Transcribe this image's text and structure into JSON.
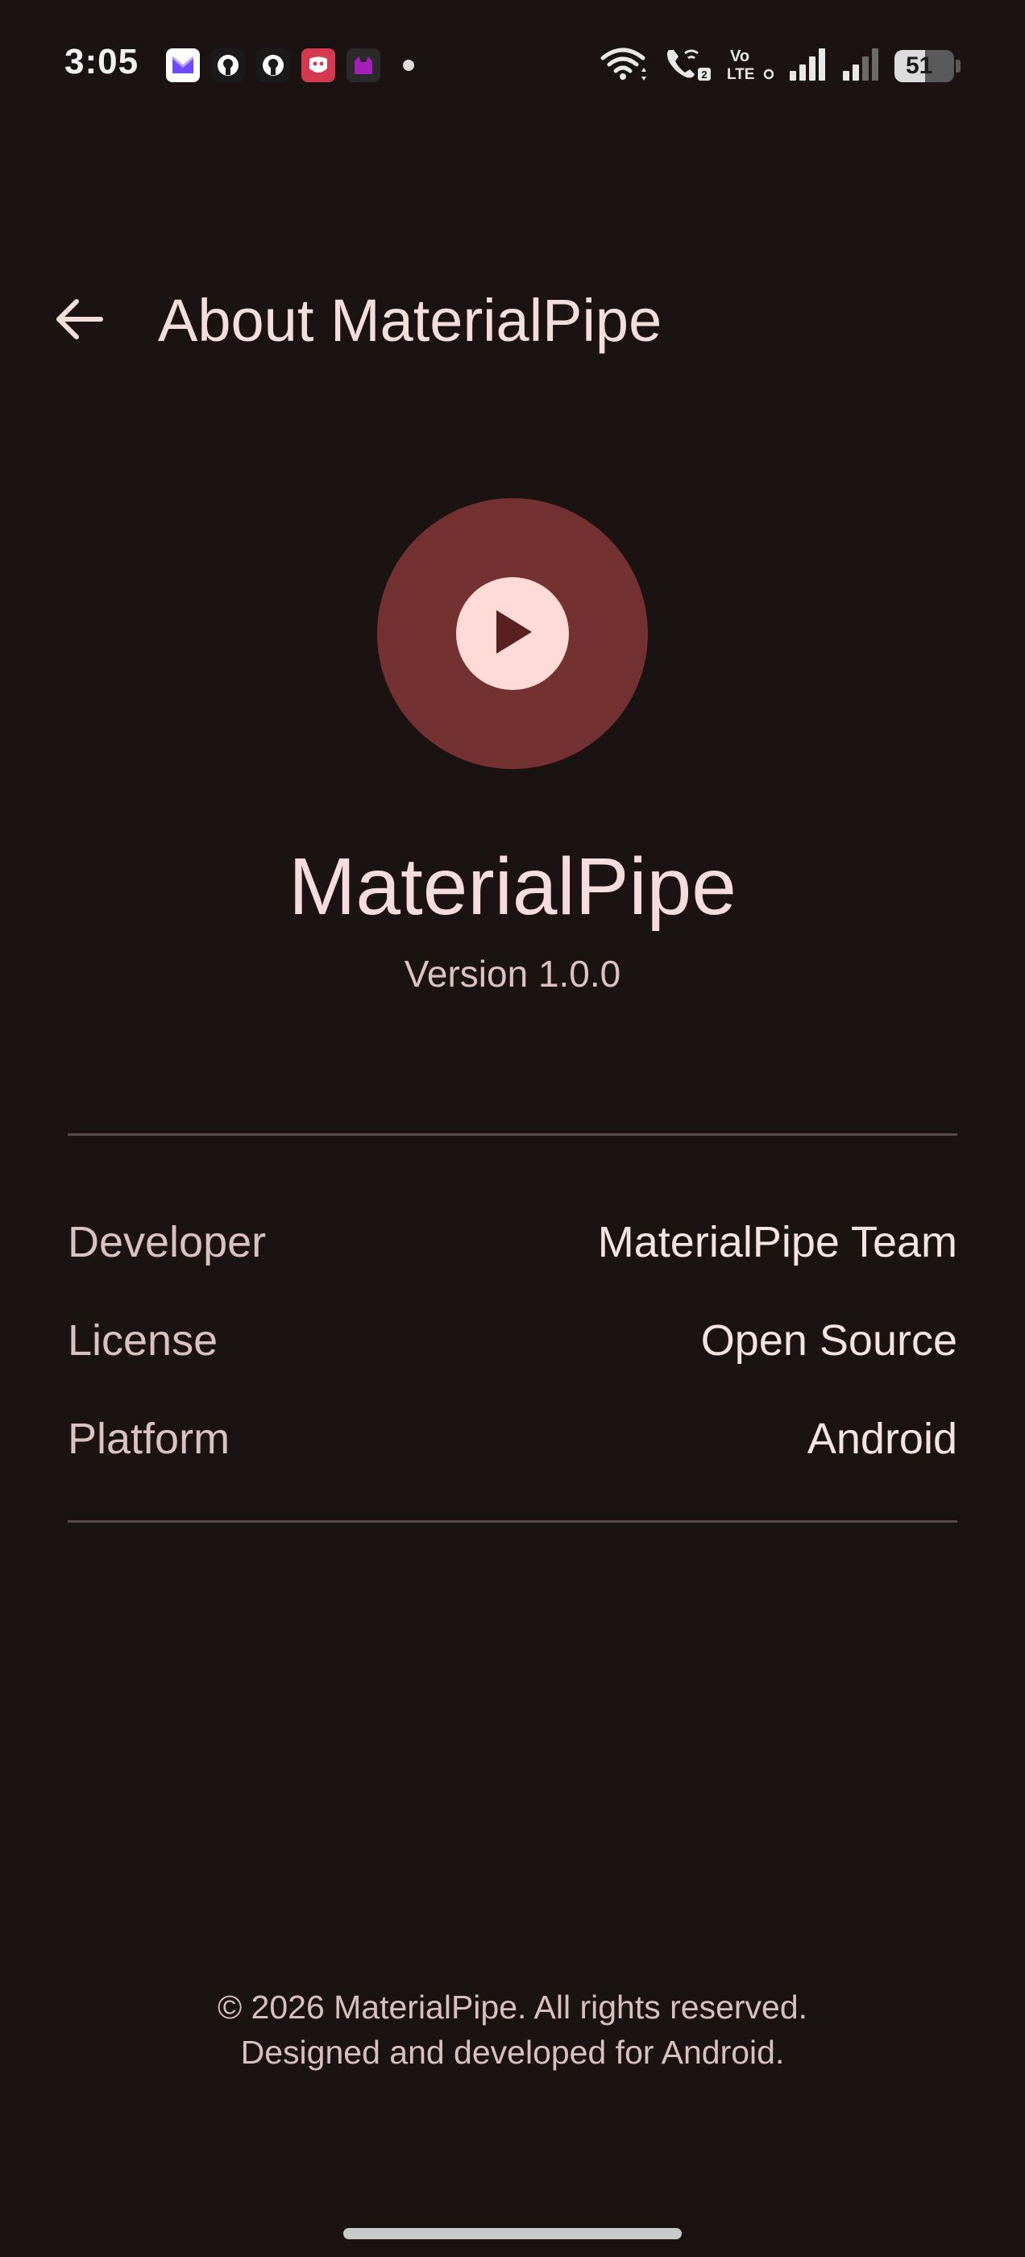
{
  "status_bar": {
    "time": "3:05",
    "notification_icons": [
      "proton-mail-icon",
      "github-icon",
      "github-icon",
      "app-red-icon",
      "app-purple-icon"
    ],
    "network": "LTE",
    "volte_label": "Vo",
    "sim2_label": "2",
    "battery_level": "51"
  },
  "app_bar": {
    "title": "About MaterialPipe"
  },
  "app_info": {
    "name": "MaterialPipe",
    "version": "Version 1.0.0"
  },
  "details": [
    {
      "label": "Developer",
      "value": "MaterialPipe Team"
    },
    {
      "label": "License",
      "value": "Open Source"
    },
    {
      "label": "Platform",
      "value": "Android"
    }
  ],
  "footer": {
    "copyright": "© 2026 MaterialPipe. All rights reserved.",
    "tagline": "Designed and developed for Android."
  },
  "colors": {
    "background": "#1b1212",
    "logo_outer": "#733131",
    "logo_inner": "#ffdad6",
    "text_primary": "#f4dedc"
  }
}
